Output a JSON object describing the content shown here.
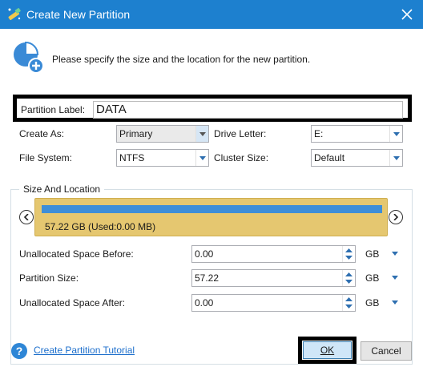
{
  "window": {
    "title": "Create New Partition",
    "title_icon": "wand-icon",
    "close_icon": "close-icon",
    "title_color": "#1d80cf"
  },
  "header": {
    "icon": "pie-plus-icon",
    "text": "Please specify the size and the location for the new partition."
  },
  "form": {
    "partition_label": {
      "label": "Partition Label:",
      "value": "DATA"
    },
    "create_as": {
      "label": "Create As:",
      "value": "Primary"
    },
    "drive_letter": {
      "label": "Drive Letter:",
      "value": "E:"
    },
    "file_system": {
      "label": "File System:",
      "value": "NTFS"
    },
    "cluster_size": {
      "label": "Cluster Size:",
      "value": "Default"
    }
  },
  "size_location": {
    "title": "Size And Location",
    "partition_bar": {
      "text": "57.22 GB (Used:0.00 MB)",
      "used_fill_fraction": 1.0,
      "bar_color": "#e5c770",
      "used_color": "#3e8ed8"
    },
    "fields": [
      {
        "label": "Unallocated Space Before:",
        "value": "0.00",
        "unit": "GB"
      },
      {
        "label": "Partition Size:",
        "value": "57.22",
        "unit": "GB"
      },
      {
        "label": "Unallocated Space After:",
        "value": "0.00",
        "unit": "GB"
      }
    ]
  },
  "footer": {
    "help_link": "Create Partition Tutorial",
    "ok_label": "OK",
    "cancel_label": "Cancel"
  }
}
